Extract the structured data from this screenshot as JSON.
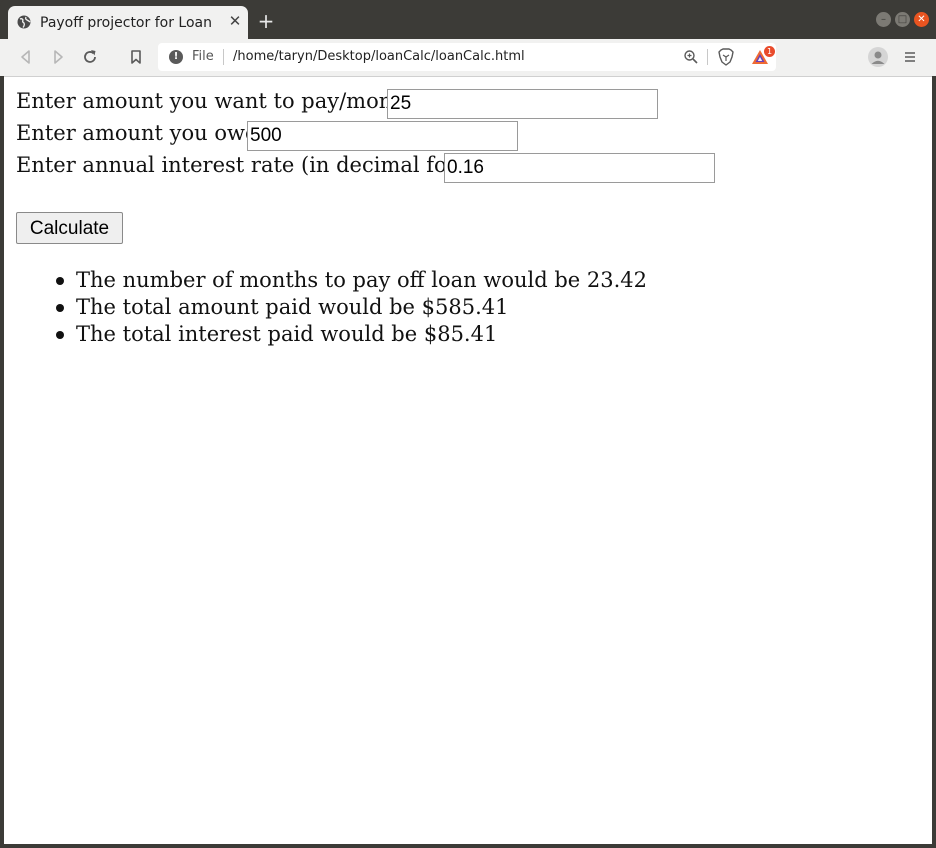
{
  "browser": {
    "tab": {
      "title": "Payoff projector for Loan",
      "favicon": "globe-icon",
      "close_icon": "close-icon"
    },
    "new_tab_icon": "plus-icon",
    "window_controls": {
      "minimize": "minimize-icon",
      "maximize": "maximize-icon",
      "close": "close-icon"
    },
    "toolbar": {
      "back_icon": "back-arrow-icon",
      "forward_icon": "forward-arrow-icon",
      "reload_icon": "reload-icon",
      "bookmark_icon": "bookmark-icon",
      "address": {
        "info_icon": "info-icon",
        "scheme_label": "File",
        "url": "/home/taryn/Desktop/loanCalc/loanCalc.html"
      },
      "zoom_icon": "zoom-icon",
      "brave_shields_icon": "brave-lion-icon",
      "rewards_icon": "brave-rewards-icon",
      "rewards_badge": "1",
      "profile_icon": "profile-icon",
      "menu_icon": "menu-icon"
    },
    "colors": {
      "titlebar": "#3c3b37",
      "toolbar": "#f1f1f0",
      "close_button": "#e95420",
      "badge": "#e94b2b"
    }
  },
  "page": {
    "form": {
      "monthly_payment": {
        "label": "Enter amount you want to pay/month:",
        "value": "25"
      },
      "amount_owed": {
        "label": "Enter amount you owe:",
        "value": "500"
      },
      "interest_rate": {
        "label": "Enter annual interest rate (in decimal form):",
        "value": "0.16"
      },
      "calculate_label": "Calculate"
    },
    "results": [
      "The number of months to pay off loan would be 23.42",
      "The total amount paid would be $585.41",
      "The total interest paid would be $85.41"
    ]
  }
}
